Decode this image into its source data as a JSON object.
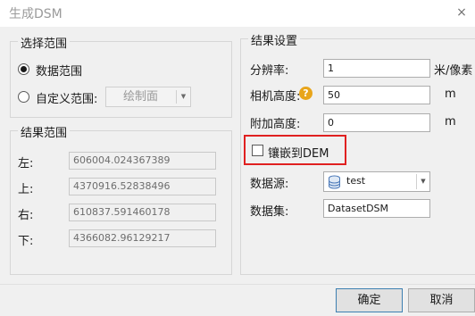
{
  "window": {
    "title": "生成DSM",
    "close_label": "×"
  },
  "range_select": {
    "title": "选择范围",
    "option_data": "数据范围",
    "option_custom": "自定义范围:",
    "selected": "数据范围",
    "draw_button": "绘制面",
    "draw_arrow": "▼"
  },
  "result_range": {
    "title": "结果范围",
    "left_label": "左:",
    "left_value": "606004.024367389",
    "top_label": "上:",
    "top_value": "4370916.52838496",
    "right_label": "右:",
    "right_value": "610837.591460178",
    "bottom_label": "下:",
    "bottom_value": "4366082.96129217"
  },
  "result_settings": {
    "title": "结果设置",
    "resolution_label": "分辨率:",
    "resolution_value": "1",
    "resolution_unit": "米/像素",
    "camera_height_label": "相机高度:",
    "camera_height_help": "?",
    "camera_height_value": "50",
    "camera_height_unit": "m",
    "extra_height_label": "附加高度:",
    "extra_height_value": "0",
    "extra_height_unit": "m",
    "mosaic_label": "镶嵌到DEM",
    "mosaic_checked": false,
    "datasource_label": "数据源:",
    "datasource_value": "test",
    "datasource_arrow": "▼",
    "dataset_label": "数据集:",
    "dataset_value": "DatasetDSM"
  },
  "footer": {
    "ok_label": "确定",
    "cancel_label": "取消"
  },
  "colors": {
    "highlight_border": "#e02020",
    "help_icon": "#e8a51b",
    "dialog_bg": "#f0f0f0"
  }
}
